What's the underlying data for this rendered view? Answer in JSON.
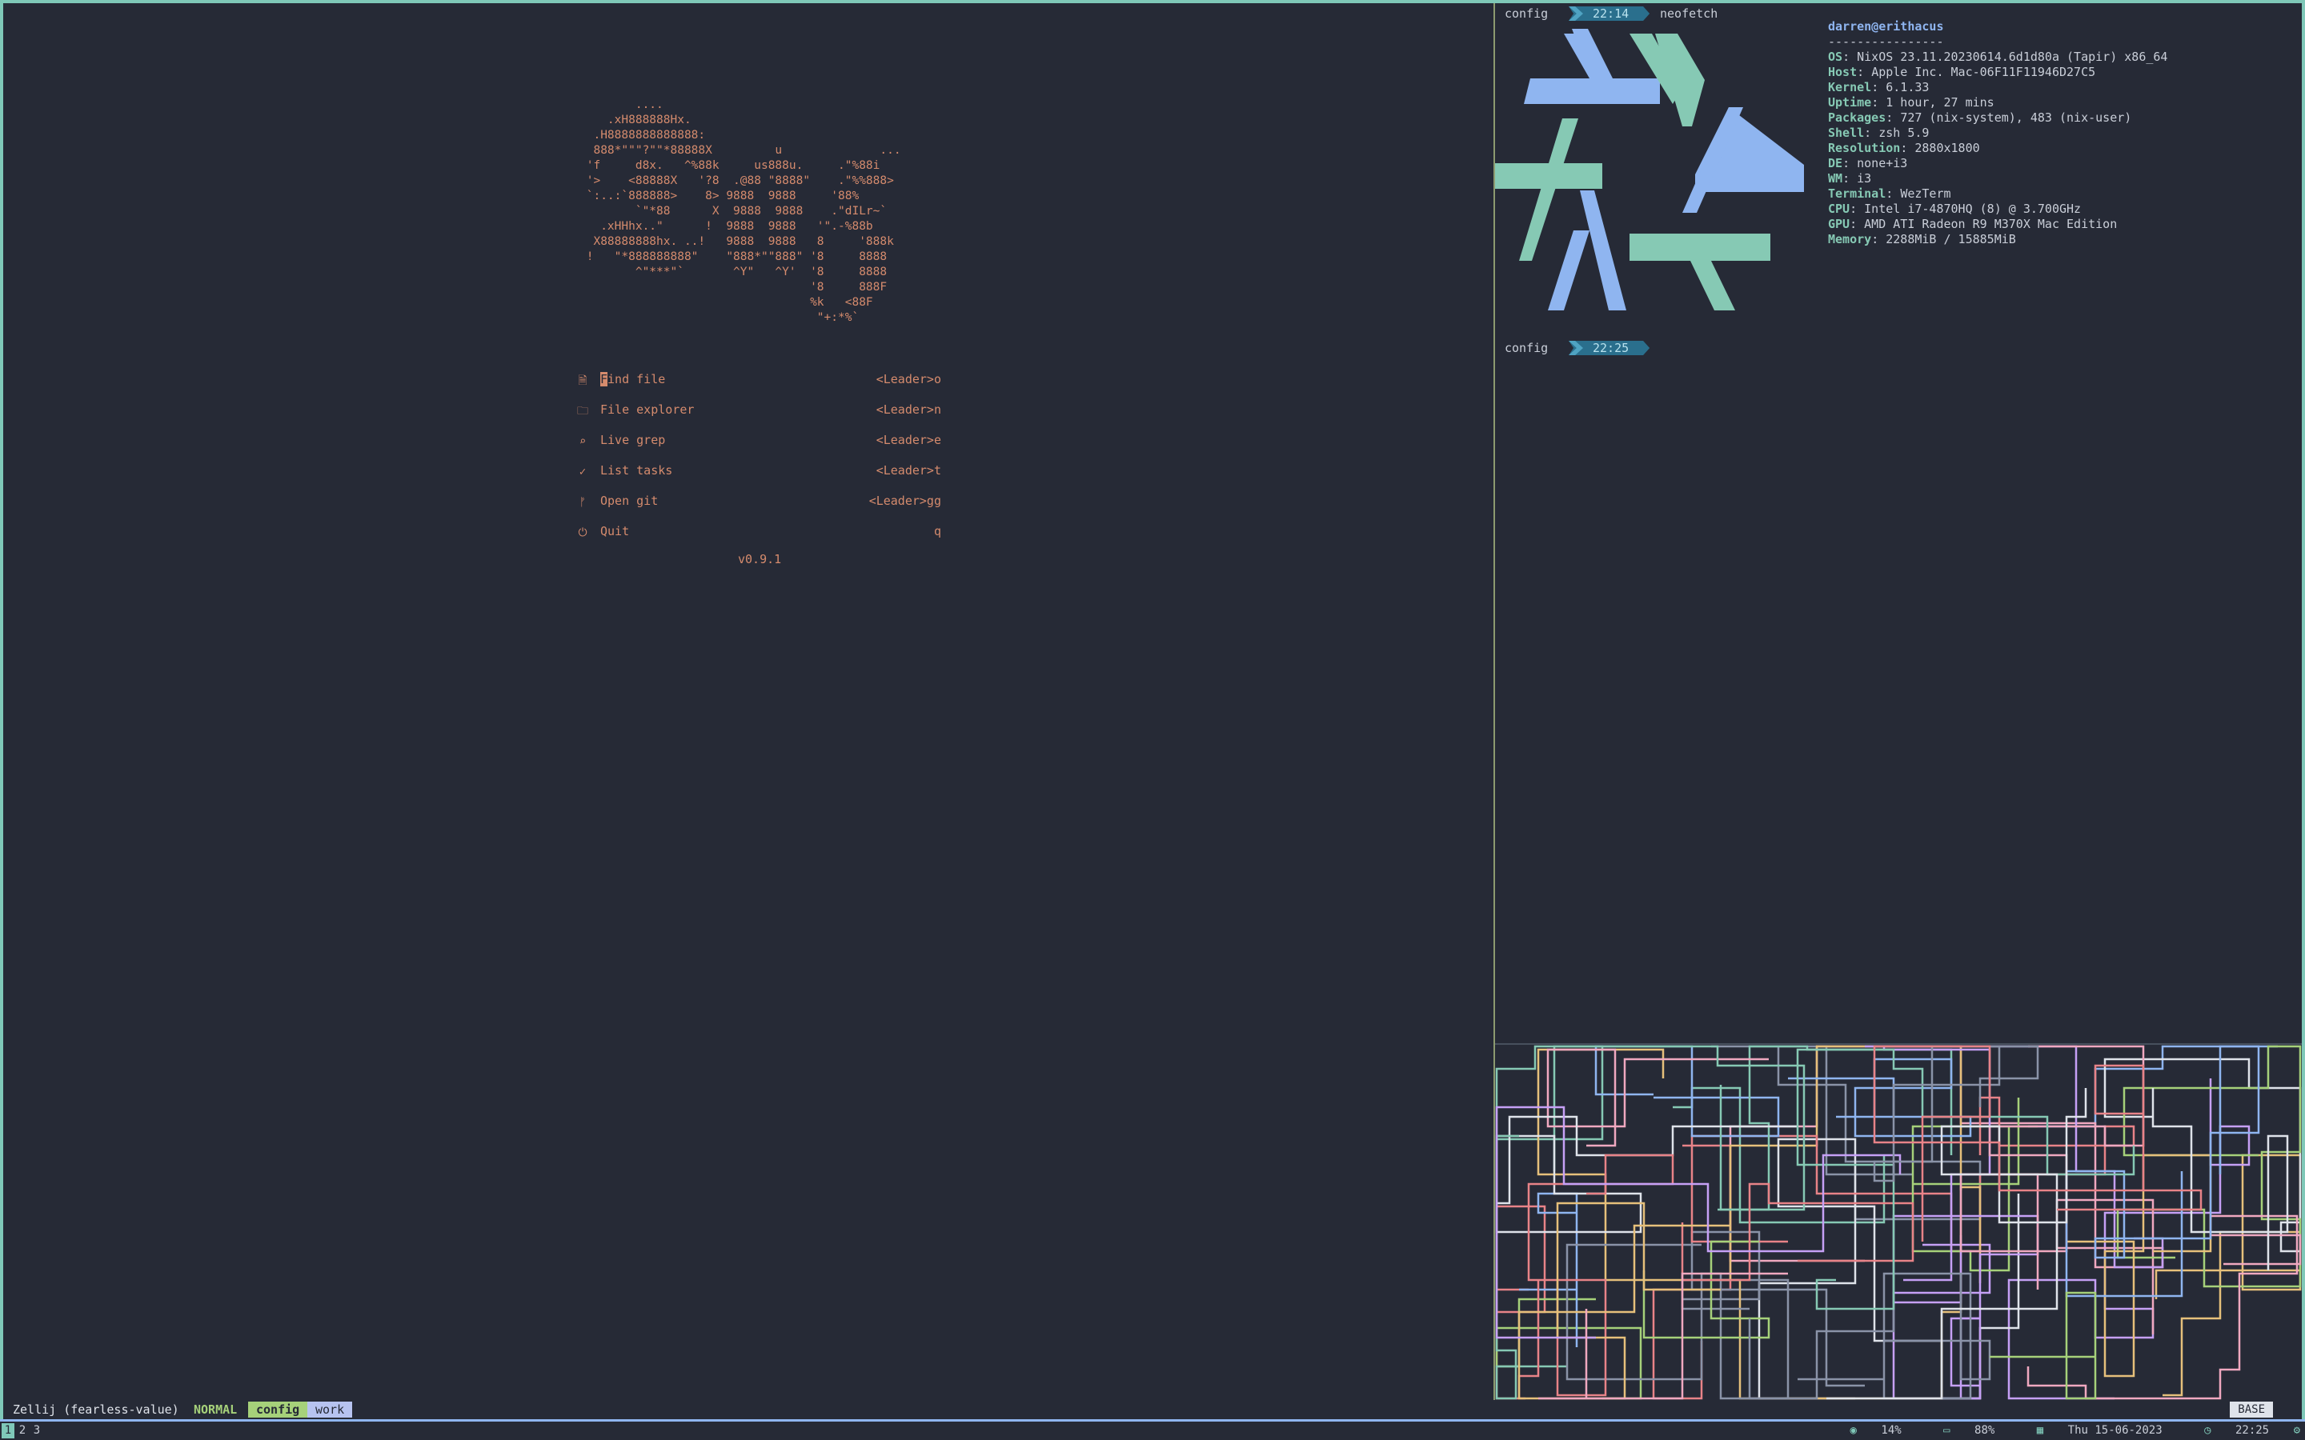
{
  "nvim": {
    "ascii_art": "        ....\n    .xH888888Hx.\n  .H8888888888888:\n  888*\"\"\"?\"\"*88888X         u              ...\n 'f     d8x.   ^%88k     us888u.     .\"%88i\n '>    <88888X   '?8  .@88 \"8888\"    .\"%%888>\n `:..:`888888>    8> 9888  9888     '88%\n        `\"*88      X  9888  9888    .\"dILr~`\n   .xHHhx..\"      !  9888  9888   '\".-%88b\n  X88888888hx. ..!   9888  9888   8     '888k\n !   \"*888888888\"    \"888*\"\"888\" '8     8888\n        ^\"***\"`       ^Y\"   ^Y'  '8     8888\n                                 '8     888F\n                                 %k   <88F\n                                  \"+:*%`",
    "menu": [
      {
        "icon": "file-icon",
        "glyph": "🗎",
        "label": "Find file",
        "key": "<Leader>o"
      },
      {
        "icon": "folder-icon",
        "glyph": "🗀",
        "label": "File explorer",
        "key": "<Leader>n"
      },
      {
        "icon": "search-icon",
        "glyph": "⌕",
        "label": "Live grep",
        "key": "<Leader>e"
      },
      {
        "icon": "check-icon",
        "glyph": "✓",
        "label": "List tasks",
        "key": "<Leader>t"
      },
      {
        "icon": "git-branch-icon",
        "glyph": "ᚠ",
        "label": "Open git",
        "key": "<Leader>gg"
      },
      {
        "icon": "power-icon",
        "glyph": "⏻",
        "label": "Quit",
        "key": "q"
      }
    ],
    "version": "v0.9.1"
  },
  "terminal": {
    "prompt1": {
      "dir": "config",
      "time": "22:14",
      "command": "neofetch"
    },
    "prompt2": {
      "dir": "config",
      "time": "22:25"
    },
    "neofetch": {
      "user_host": "darren@erithacus",
      "separator": "----------------",
      "rows": [
        {
          "key": "OS",
          "value": "NixOS 23.11.20230614.6d1d80a (Tapir) x86_64"
        },
        {
          "key": "Host",
          "value": "Apple Inc. Mac-06F11F11946D27C5"
        },
        {
          "key": "Kernel",
          "value": "6.1.33"
        },
        {
          "key": "Uptime",
          "value": "1 hour, 27 mins"
        },
        {
          "key": "Packages",
          "value": "727 (nix-system), 483 (nix-user)"
        },
        {
          "key": "Shell",
          "value": "zsh 5.9"
        },
        {
          "key": "Resolution",
          "value": "2880x1800"
        },
        {
          "key": "DE",
          "value": "none+i3"
        },
        {
          "key": "WM",
          "value": "i3"
        },
        {
          "key": "Terminal",
          "value": "WezTerm"
        },
        {
          "key": "CPU",
          "value": "Intel i7-4870HQ (8) @ 3.700GHz"
        },
        {
          "key": "GPU",
          "value": "AMD ATI Radeon R9 M370X Mac Edition"
        },
        {
          "key": "Memory",
          "value": "2288MiB / 15885MiB"
        }
      ]
    },
    "logo_colors": {
      "blue": "#8fb5f0",
      "teal": "#86c9b4"
    }
  },
  "zellij": {
    "session": "Zellij (fearless-value)",
    "mode": "NORMAL",
    "tabs": [
      {
        "label": "config",
        "active": true
      },
      {
        "label": "work",
        "active": false
      }
    ],
    "base_label": "BASE"
  },
  "i3bar": {
    "workspaces": [
      "1",
      "2",
      "3"
    ],
    "active_workspace": "1",
    "status": [
      {
        "icon": "cpu-icon",
        "glyph": "◉",
        "text": "14%"
      },
      {
        "icon": "battery-icon",
        "glyph": "▭",
        "text": "88%"
      },
      {
        "icon": "calendar-icon",
        "glyph": "▦",
        "text": "Thu 15-06-2023"
      },
      {
        "icon": "clock-icon",
        "glyph": "◷",
        "text": "22:25"
      }
    ],
    "tray_glyph": "⚙"
  },
  "colors": {
    "background": "#262a36",
    "frame": "#7fc8b8",
    "accent_orange": "#d58b6d",
    "pipe_colors": [
      "#e88388",
      "#8fb5f0",
      "#a6d17a",
      "#86c9b4",
      "#e6c07b",
      "#c6a0f6",
      "#f0a8c0",
      "#dfe3ea",
      "#8a93a8"
    ]
  }
}
